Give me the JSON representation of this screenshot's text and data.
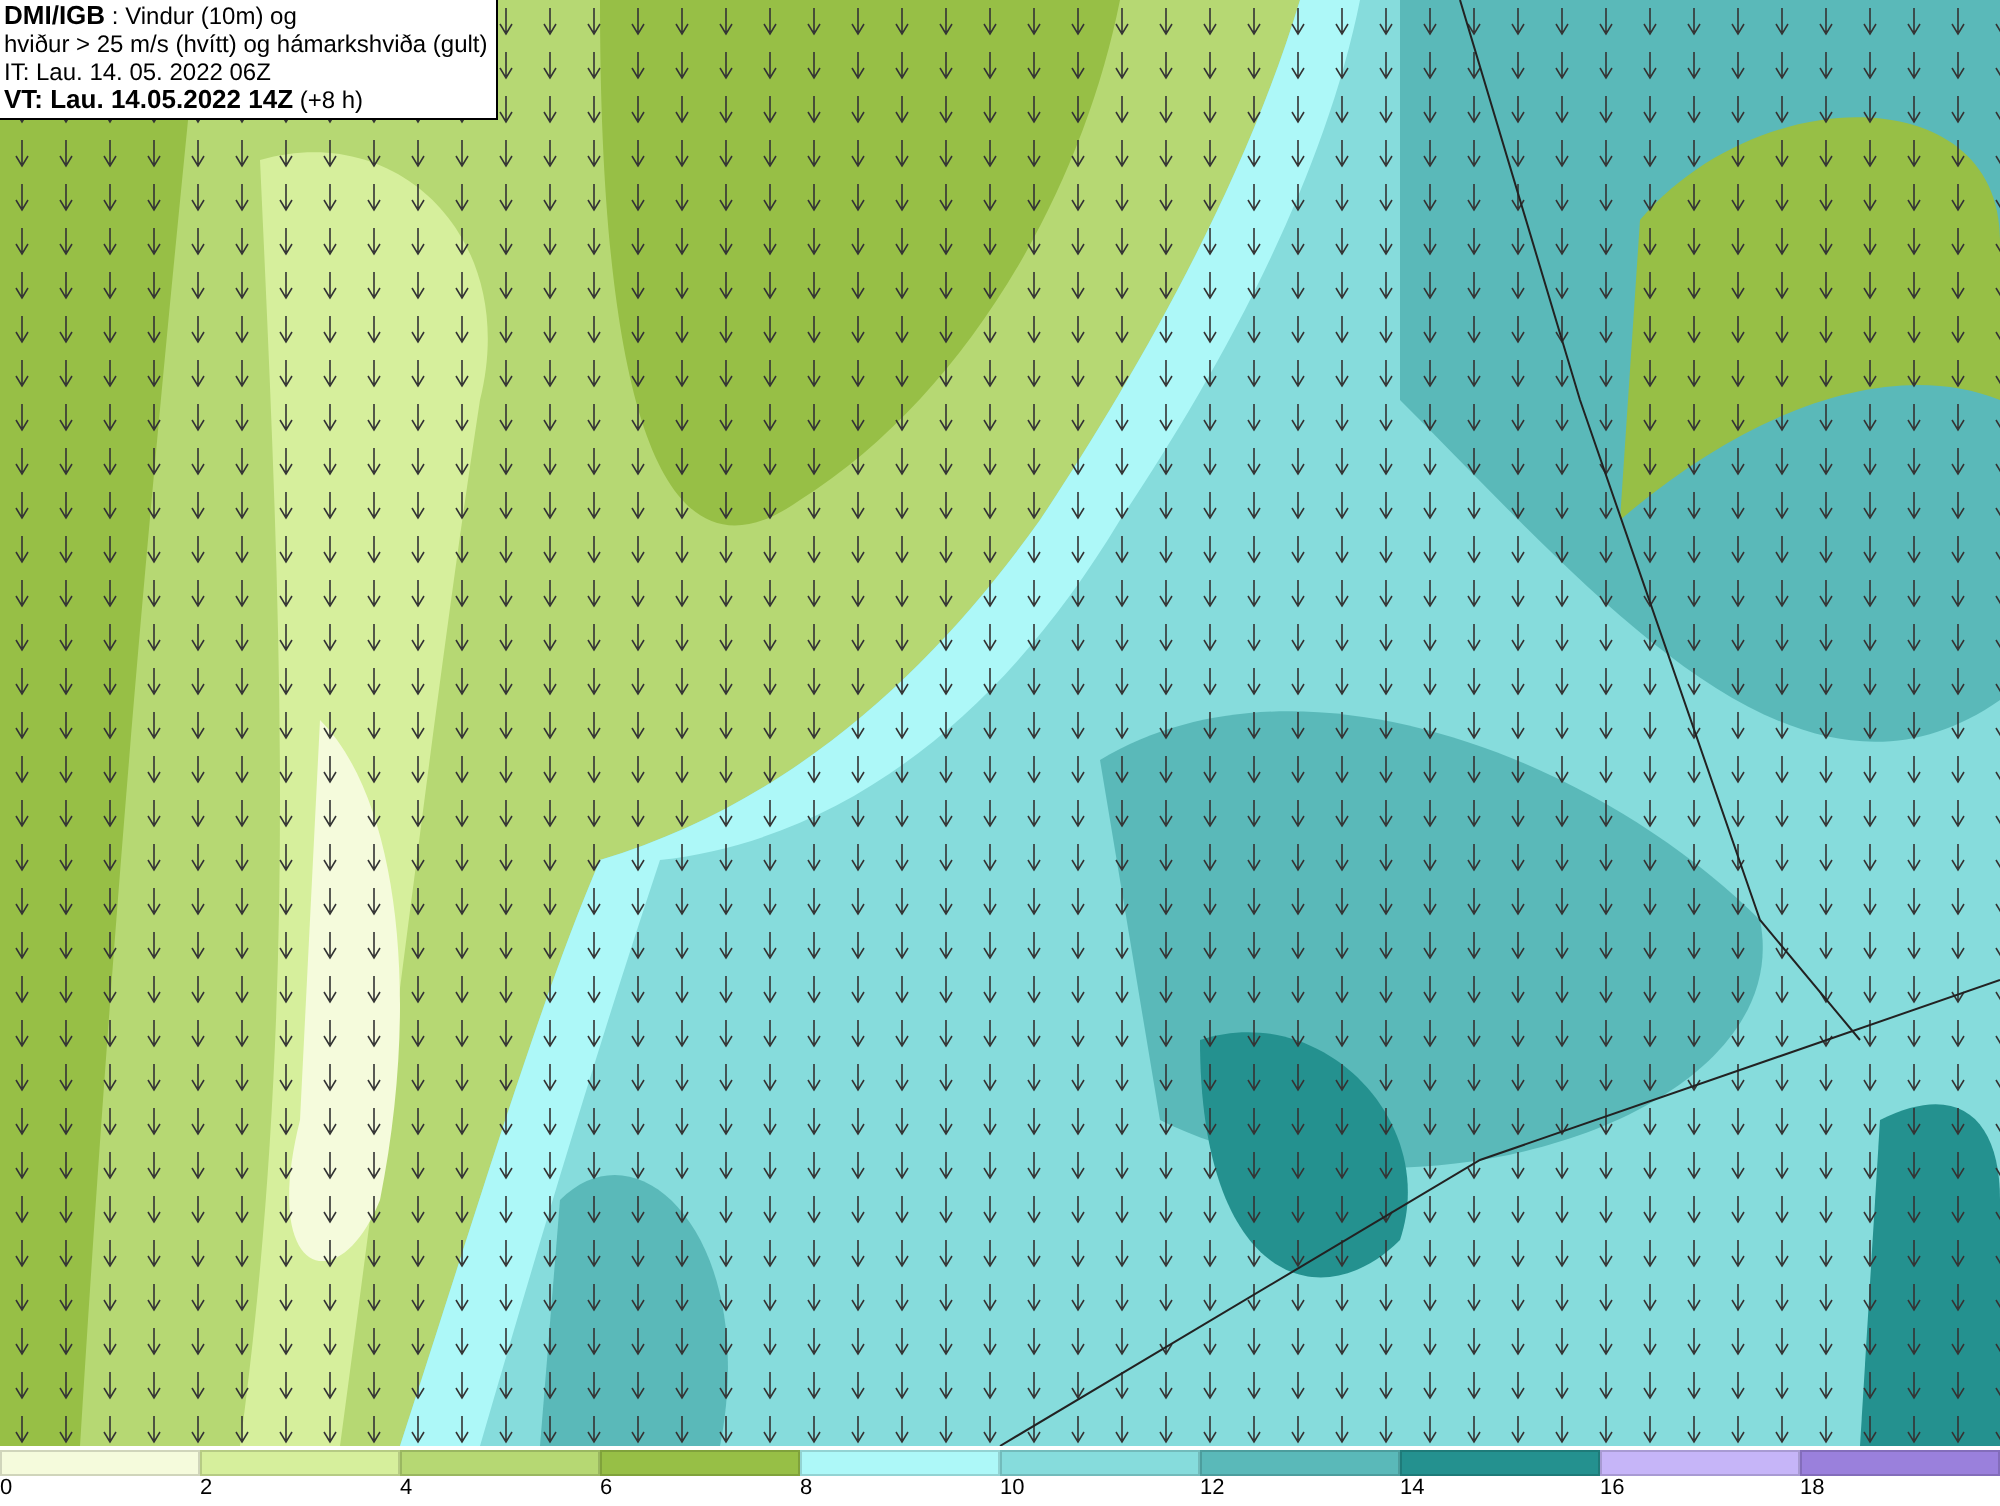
{
  "header": {
    "lines": [
      "**DMI/IGB** : Vindur (10m) og",
      "hviður > 25 m/s (hvítt) og hámarkshviða (gult)",
      "IT: Lau. 14. 05. 2022 06Z",
      "**VT: Lau. 14.05.2022 14Z** (+8 h)"
    ]
  },
  "legend": {
    "bins": [
      {
        "label": "0",
        "color": "#f5fbdc"
      },
      {
        "label": "2",
        "color": "#d6ef9c"
      },
      {
        "label": "4",
        "color": "#b6d873"
      },
      {
        "label": "6",
        "color": "#97bf46"
      },
      {
        "label": "8",
        "color": "#adf8f8"
      },
      {
        "label": "10",
        "color": "#86dcdc"
      },
      {
        "label": "12",
        "color": "#5ab9b9"
      },
      {
        "label": "14",
        "color": "#24918f"
      },
      {
        "label": "16",
        "color": "#c6b5f8"
      },
      {
        "label": "18",
        "color": "#9a80dc"
      }
    ]
  }
}
